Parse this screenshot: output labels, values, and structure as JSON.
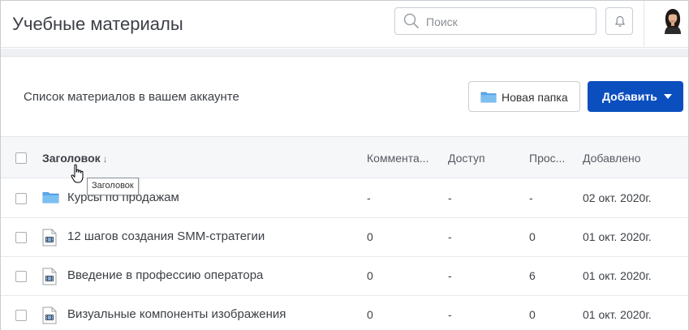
{
  "header": {
    "title": "Учебные материалы",
    "search_placeholder": "Поиск",
    "icons": [
      "search-icon",
      "bell-icon",
      "avatar"
    ]
  },
  "toolbar": {
    "subtitle": "Список материалов в вашем аккаунте",
    "new_folder_label": "Новая папка",
    "add_label": "Добавить",
    "accent_color": "#0b4fbf"
  },
  "table": {
    "columns": {
      "title": "Заголовок",
      "title_sort_icon": "↓",
      "comments": "Коммента...",
      "access": "Доступ",
      "views": "Прос...",
      "added": "Добавлено"
    },
    "rows": [
      {
        "icon": "folder-icon",
        "name": "Курсы по продажам",
        "comments": "-",
        "access": "-",
        "views": "-",
        "added": "02 окт. 2020г."
      },
      {
        "icon": "video-icon",
        "name": "12 шагов создания SMM-стратегии",
        "comments": "0",
        "access": "-",
        "views": "0",
        "added": "01 окт. 2020г."
      },
      {
        "icon": "video-icon",
        "name": "Введение в профессию оператора",
        "comments": "0",
        "access": "-",
        "views": "6",
        "added": "01 окт. 2020г."
      },
      {
        "icon": "video-icon",
        "name": "Визуальные компоненты изображения",
        "comments": "0",
        "access": "-",
        "views": "0",
        "added": "01 окт. 2020г."
      }
    ]
  },
  "tooltip": {
    "text": "Заголовок"
  }
}
